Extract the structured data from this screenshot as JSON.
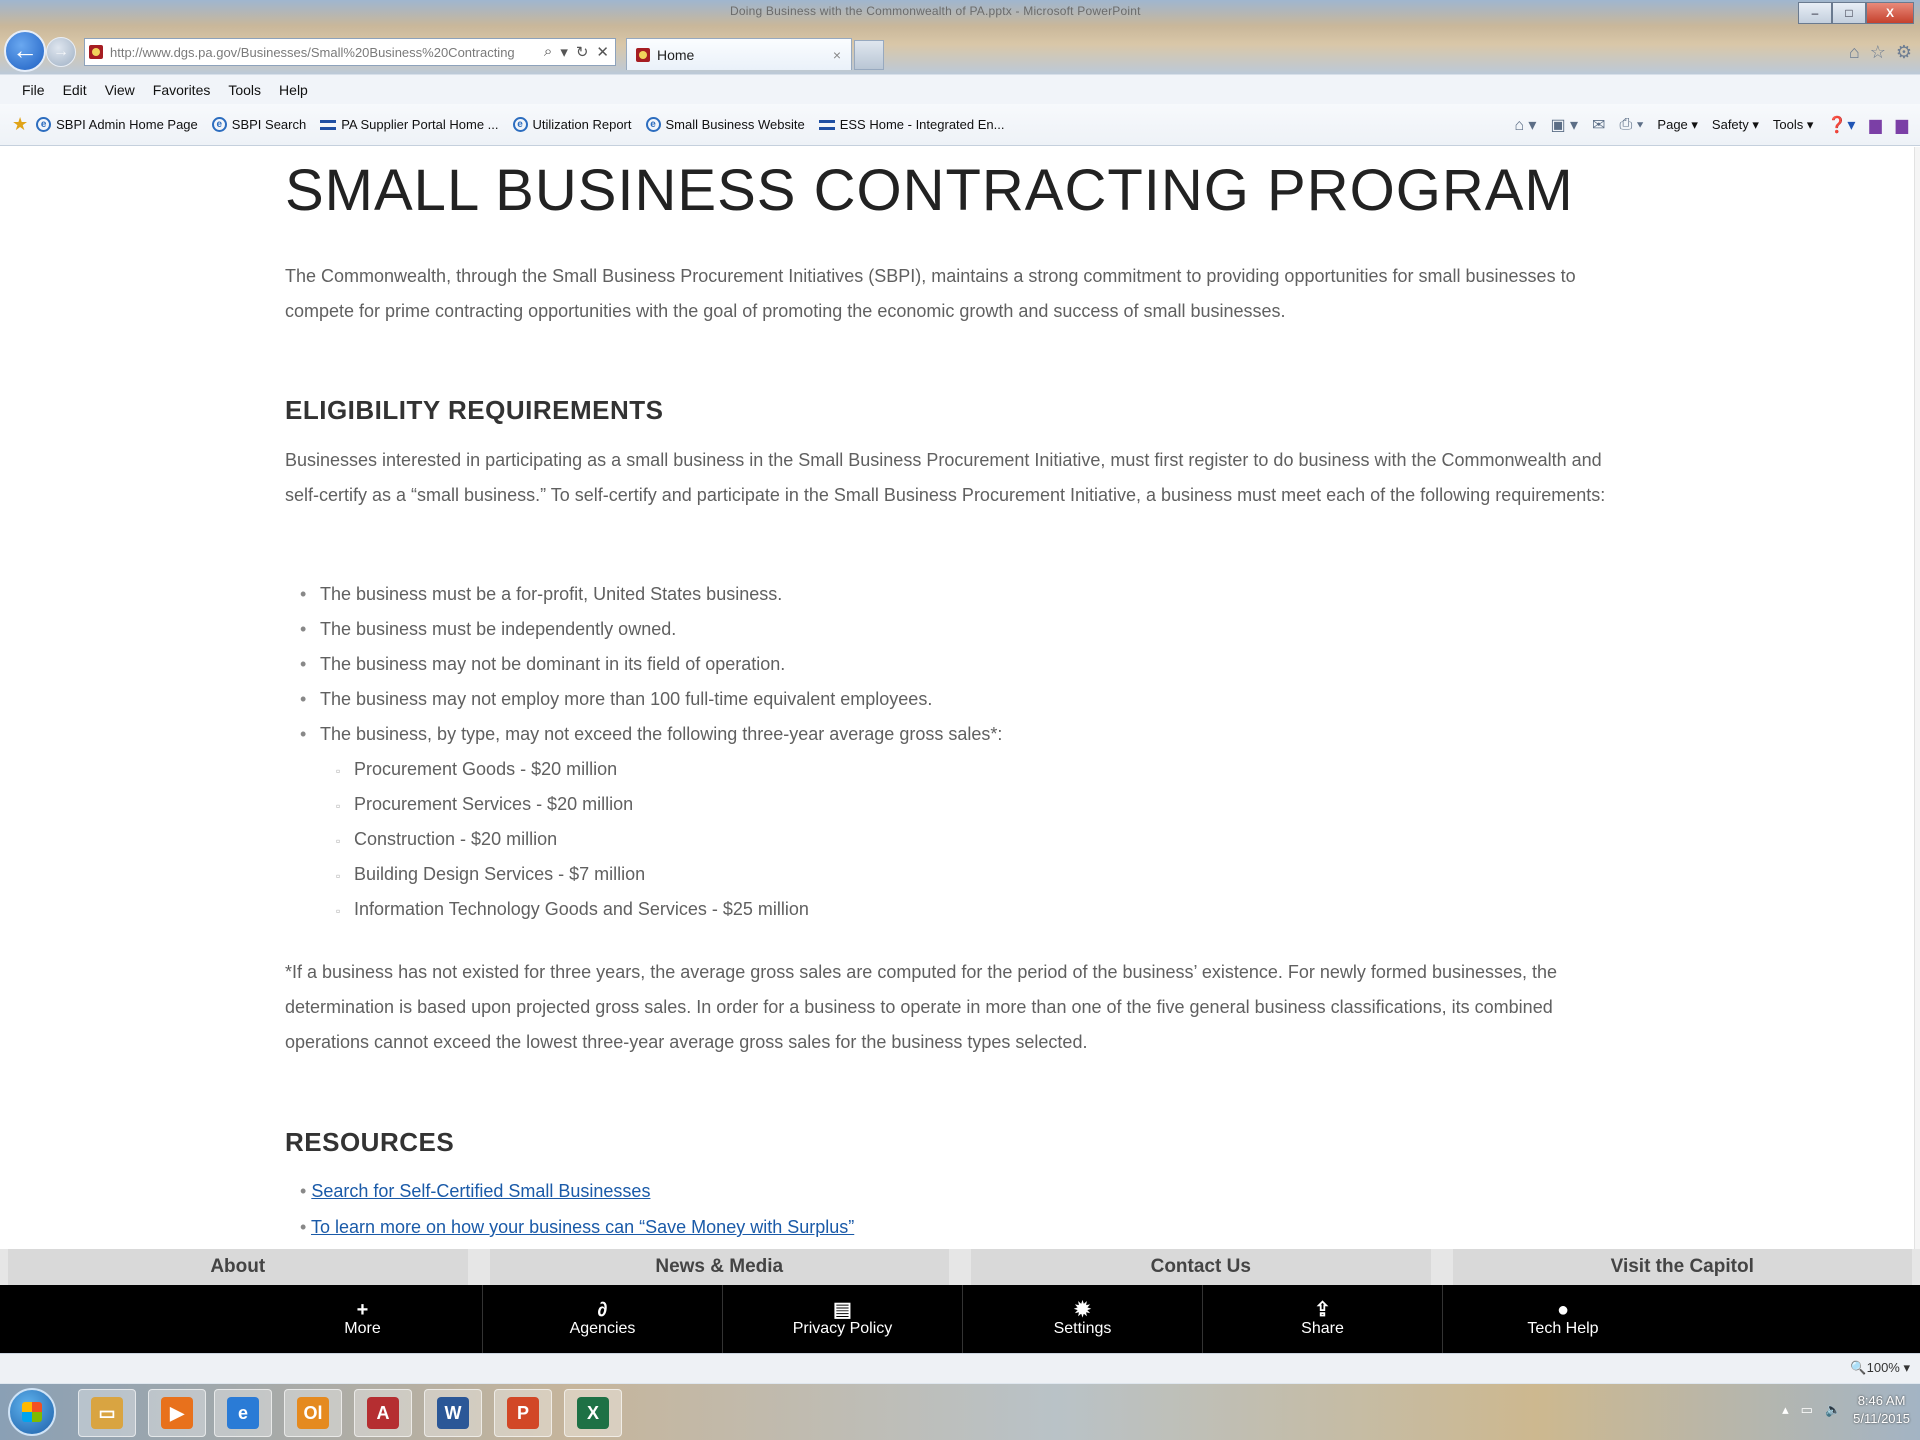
{
  "window": {
    "title": "Doing Business with the Commonwealth of PA.pptx - Microsoft PowerPoint",
    "minimize": "–",
    "maximize": "□",
    "close": "X"
  },
  "browser": {
    "url": "http://www.dgs.pa.gov/Businesses/Small%20Business%20Contracting",
    "tab_title": "Home",
    "tab_close": "×",
    "menu": [
      "File",
      "Edit",
      "View",
      "Favorites",
      "Tools",
      "Help"
    ],
    "favorites": [
      {
        "label": "SBPI Admin Home Page",
        "icon": "ie-icon"
      },
      {
        "label": "SBPI Search",
        "icon": "ie-icon"
      },
      {
        "label": "PA Supplier Portal Home ...",
        "icon": "ess-icon"
      },
      {
        "label": "Utilization Report",
        "icon": "ie-icon"
      },
      {
        "label": "Small Business Website",
        "icon": "ie-icon"
      },
      {
        "label": "ESS Home - Integrated En...",
        "icon": "ess-icon"
      }
    ],
    "command_bar": {
      "page": "Page ▾",
      "safety": "Safety ▾",
      "tools": "Tools ▾"
    },
    "zoom": "🔍100%  ▾"
  },
  "page": {
    "title": "SMALL BUSINESS CONTRACTING PROGRAM",
    "intro": "The Commonwealth, through the Small Business Procurement Initiatives (SBPI), maintains a strong commitment to providing opportunities for small businesses to compete for prime contracting opportunities with the goal of promoting the economic growth and success of small businesses.",
    "eligibility_heading": "ELIGIBILITY REQUIREMENTS",
    "eligibility_text": "Businesses interested in participating as a small business in the Small Business Procurement Initiative, must first register to do business with the Commonwealth and self-certify as a “small business.”  To self-certify and participate in the Small Business Procurement Initiative, a business must meet each of the following requirements:",
    "requirements": [
      "The business must be a for-profit, United States business.",
      "The business must be independently owned.",
      "The business may not be dominant in its field of operation.",
      "The business may not employ more than 100 full-time equivalent employees.",
      "The business, by type, may not exceed the following three-year average gross sales*:"
    ],
    "sales_limits": [
      "Procurement Goods - $20 million",
      "Procurement Services - $20 million",
      "Construction - $20 million",
      "Building Design Services - $7 million",
      "Information Technology Goods and Services - $25 million"
    ],
    "footnote": "*If a business has not existed for three years, the average gross sales are computed for the period of the business’ existence.  For newly formed businesses, the determination is based upon projected gross sales.  In order for a business to operate in more than one of the five general business classifications, its combined operations cannot exceed the lowest three-year average gross sales for the business types selected.",
    "resources_heading": "RESOURCES",
    "resources": [
      "Search for Self-Certified Small Businesses",
      "To learn more on how your business can “Save Money with Surplus”"
    ]
  },
  "footer": {
    "nav": [
      "About",
      "News & Media",
      "Contact Us",
      "Visit the Capitol"
    ],
    "bar": [
      {
        "label": "More",
        "icon": "+"
      },
      {
        "label": "Agencies",
        "icon": "∂"
      },
      {
        "label": "Privacy Policy",
        "icon": "▤"
      },
      {
        "label": "Settings",
        "icon": "✹"
      },
      {
        "label": "Share",
        "icon": "⇪"
      },
      {
        "label": "Tech Help",
        "icon": "●"
      }
    ]
  },
  "taskbar": {
    "apps": [
      {
        "name": "file-explorer",
        "letter": "▭",
        "color": "#d9a441"
      },
      {
        "name": "media-player",
        "letter": "▶",
        "color": "#e8711c"
      },
      {
        "name": "internet-explorer",
        "letter": "e",
        "color": "#2a7bd6"
      },
      {
        "name": "outlook",
        "letter": "Ol",
        "color": "#e58a1f"
      },
      {
        "name": "access",
        "letter": "A",
        "color": "#b52e31"
      },
      {
        "name": "word",
        "letter": "W",
        "color": "#2b5797"
      },
      {
        "name": "powerpoint",
        "letter": "P",
        "color": "#d24726"
      },
      {
        "name": "excel",
        "letter": "X",
        "color": "#1e7145"
      }
    ],
    "time": "8:46 AM",
    "date": "5/11/2015"
  }
}
